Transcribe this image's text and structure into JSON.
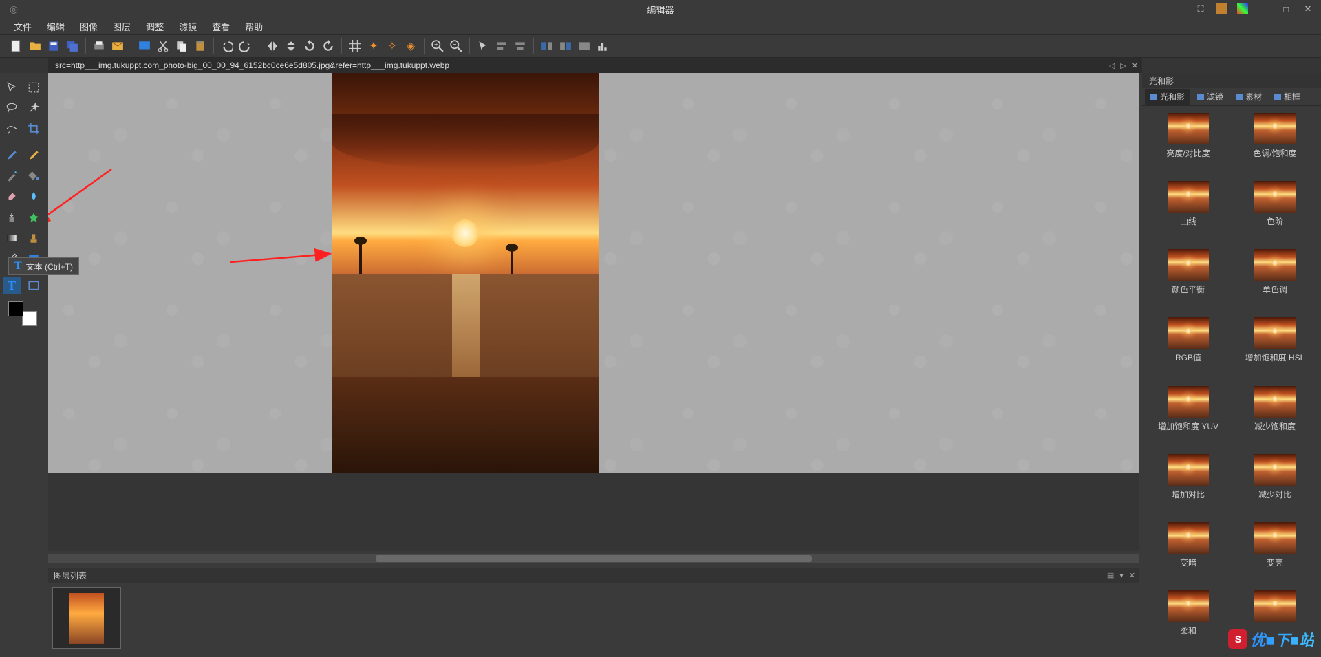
{
  "titlebar": {
    "title": "编辑器"
  },
  "menu": [
    "文件",
    "编辑",
    "图像",
    "图层",
    "调整",
    "滤镜",
    "查看",
    "帮助"
  ],
  "document_tab": "src=http___img.tukuppt.com_photo-big_00_00_94_6152bc0ce6e5d805.jpg&refer=http___img.tukuppt.webp",
  "tooltip": "文本 (Ctrl+T)",
  "layers_panel_title": "图层列表",
  "right_panel": {
    "title": "光和影",
    "tabs": [
      "光和影",
      "滤镜",
      "素材",
      "相框"
    ],
    "effects": [
      "亮度/对比度",
      "色调/饱和度",
      "曲线",
      "色阶",
      "颜色平衡",
      "单色调",
      "RGB值",
      "增加饱和度 HSL",
      "增加饱和度 YUV",
      "减少饱和度",
      "增加对比",
      "减少对比",
      "变暗",
      "变亮",
      "柔和",
      ""
    ]
  },
  "watermark": {
    "badge": "S",
    "text": "优■下■站"
  }
}
